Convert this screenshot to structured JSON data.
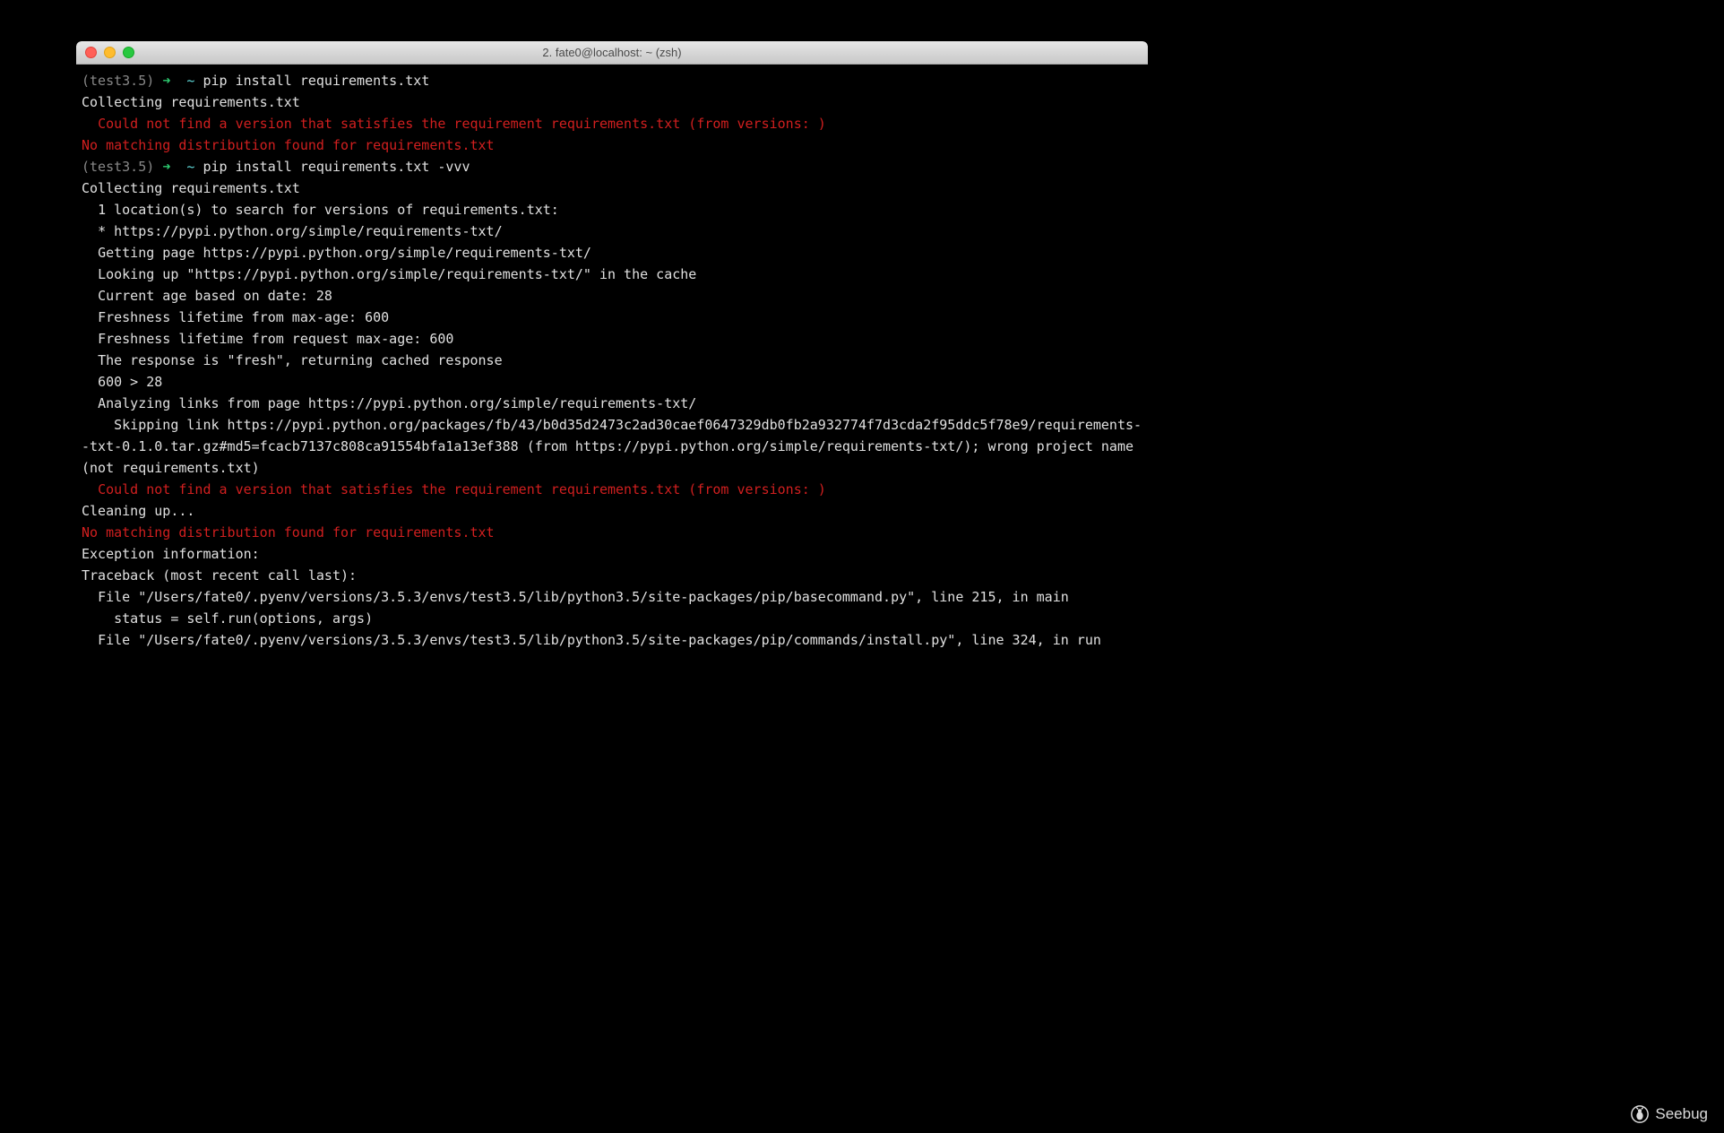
{
  "window": {
    "title": "2. fate0@localhost: ~ (zsh)"
  },
  "colors": {
    "traffic_close": "#ff5f57",
    "traffic_min": "#febc2e",
    "traffic_zoom": "#28c840",
    "prompt_gray": "#888888",
    "prompt_arrow": "#2ecc71",
    "prompt_cyan": "#5fd7d7",
    "text_default": "#e0e0e0",
    "text_error": "#d11f1f"
  },
  "terminal": {
    "lines": [
      {
        "segments": [
          {
            "text": "(test3.5) ",
            "class": "c-prompt"
          },
          {
            "text": "➜  ",
            "class": "c-arrow"
          },
          {
            "text": "~ ",
            "class": "c-cyan"
          },
          {
            "text": "pip install requirements.txt",
            "class": "c-white"
          }
        ]
      },
      {
        "segments": [
          {
            "text": "Collecting requirements.txt",
            "class": "c-white"
          }
        ]
      },
      {
        "segments": [
          {
            "text": "  Could not find a version that satisfies the requirement requirements.txt (from versions: )",
            "class": "c-red"
          }
        ]
      },
      {
        "segments": [
          {
            "text": "No matching distribution found for requirements.txt",
            "class": "c-red"
          }
        ]
      },
      {
        "segments": [
          {
            "text": "(test3.5) ",
            "class": "c-prompt"
          },
          {
            "text": "➜  ",
            "class": "c-arrow"
          },
          {
            "text": "~ ",
            "class": "c-cyan"
          },
          {
            "text": "pip install requirements.txt -vvv",
            "class": "c-white"
          }
        ]
      },
      {
        "segments": [
          {
            "text": "Collecting requirements.txt",
            "class": "c-white"
          }
        ]
      },
      {
        "segments": [
          {
            "text": "  1 location(s) to search for versions of requirements.txt:",
            "class": "c-white"
          }
        ]
      },
      {
        "segments": [
          {
            "text": "  * https://pypi.python.org/simple/requirements-txt/",
            "class": "c-white"
          }
        ]
      },
      {
        "segments": [
          {
            "text": "  Getting page https://pypi.python.org/simple/requirements-txt/",
            "class": "c-white"
          }
        ]
      },
      {
        "segments": [
          {
            "text": "  Looking up \"https://pypi.python.org/simple/requirements-txt/\" in the cache",
            "class": "c-white"
          }
        ]
      },
      {
        "segments": [
          {
            "text": "  Current age based on date: 28",
            "class": "c-white"
          }
        ]
      },
      {
        "segments": [
          {
            "text": "  Freshness lifetime from max-age: 600",
            "class": "c-white"
          }
        ]
      },
      {
        "segments": [
          {
            "text": "  Freshness lifetime from request max-age: 600",
            "class": "c-white"
          }
        ]
      },
      {
        "segments": [
          {
            "text": "  The response is \"fresh\", returning cached response",
            "class": "c-white"
          }
        ]
      },
      {
        "segments": [
          {
            "text": "  600 > 28",
            "class": "c-white"
          }
        ]
      },
      {
        "segments": [
          {
            "text": "  Analyzing links from page https://pypi.python.org/simple/requirements-txt/",
            "class": "c-white"
          }
        ]
      },
      {
        "segments": [
          {
            "text": "    Skipping link https://pypi.python.org/packages/fb/43/b0d35d2473c2ad30caef0647329db0fb2a932774f7d3cda2f95ddc5f78e9/requirements--txt-0.1.0.tar.gz#md5=fcacb7137c808ca91554bfa1a13ef388 (from https://pypi.python.org/simple/requirements-txt/); wrong project name (not requirements.txt)",
            "class": "c-white"
          }
        ]
      },
      {
        "segments": [
          {
            "text": "  Could not find a version that satisfies the requirement requirements.txt (from versions: )",
            "class": "c-red"
          }
        ]
      },
      {
        "segments": [
          {
            "text": "Cleaning up...",
            "class": "c-white"
          }
        ]
      },
      {
        "segments": [
          {
            "text": "No matching distribution found for requirements.txt",
            "class": "c-red"
          }
        ]
      },
      {
        "segments": [
          {
            "text": "Exception information:",
            "class": "c-white"
          }
        ]
      },
      {
        "segments": [
          {
            "text": "Traceback (most recent call last):",
            "class": "c-white"
          }
        ]
      },
      {
        "segments": [
          {
            "text": "  File \"/Users/fate0/.pyenv/versions/3.5.3/envs/test3.5/lib/python3.5/site-packages/pip/basecommand.py\", line 215, in main",
            "class": "c-white"
          }
        ]
      },
      {
        "segments": [
          {
            "text": "    status = self.run(options, args)",
            "class": "c-white"
          }
        ]
      },
      {
        "segments": [
          {
            "text": "  File \"/Users/fate0/.pyenv/versions/3.5.3/envs/test3.5/lib/python3.5/site-packages/pip/commands/install.py\", line 324, in run",
            "class": "c-white"
          }
        ]
      }
    ]
  },
  "watermark": {
    "label": "Seebug"
  }
}
